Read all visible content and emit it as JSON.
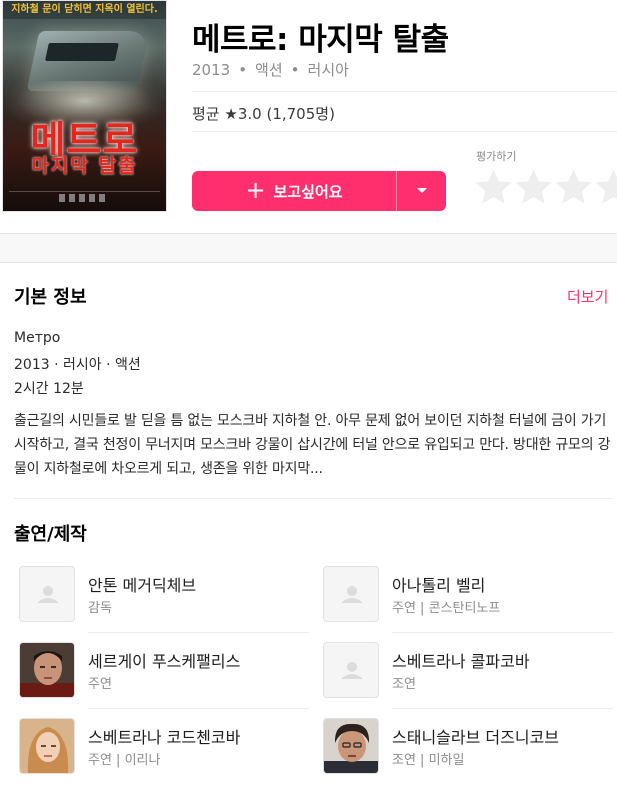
{
  "movie": {
    "title": "메트로: 마지막 탈출",
    "year": "2013",
    "genre": "액션",
    "country": "러시아",
    "rating_prefix": "평균 ★",
    "rating_value": "3.0",
    "rating_count": "(1,705명)",
    "wish_label": "보고싶어요",
    "wish_icon": "plus-icon",
    "rate_label": "평가하기",
    "stars": 5
  },
  "poster": {
    "tagline": "지하철 문이 닫히면 지옥이 열린다.",
    "title_line1": "메트로",
    "title_line2": "마지막 탈출"
  },
  "basic_info": {
    "heading": "기본 정보",
    "more_label": "더보기",
    "original_title": "Метро",
    "summary_line": "2013 · 러시아 · 액션",
    "runtime": "2시간 12분",
    "synopsis": "출근길의 시민들로 발 딛을 틈 없는 모스크바 지하철 안. 아무 문제 없어 보이던 지하철 터널에 금이 가기 시작하고, 결국 천정이 무너지며 모스크바 강물이 삽시간에 터널 안으로 유입되고 만다. 방대한 규모의 강물이 지하철로에 차오르게 되고, 생존을 위한 마지막..."
  },
  "cast": {
    "heading": "출연/제작",
    "people": [
      {
        "name": "안톤 메거딕체브",
        "role": "감독",
        "photo": "placeholder"
      },
      {
        "name": "아나톨리 벨리",
        "role": "주연 | 콘스탄티노프",
        "photo": "placeholder"
      },
      {
        "name": "세르게이 푸스케팰리스",
        "role": "주연",
        "photo": "man-dark"
      },
      {
        "name": "스베트라나 콜파코바",
        "role": "조연",
        "photo": "placeholder"
      },
      {
        "name": "스베트라나 코드첸코바",
        "role": "주연 | 이리나",
        "photo": "woman-blonde"
      },
      {
        "name": "스태니슬라브 더즈니코브",
        "role": "조연 | 미하일",
        "photo": "man-curly"
      }
    ]
  },
  "colors": {
    "accent": "#ff2f6e",
    "star_empty": "#eeeeee",
    "muted_text": "#8c8c8c"
  }
}
